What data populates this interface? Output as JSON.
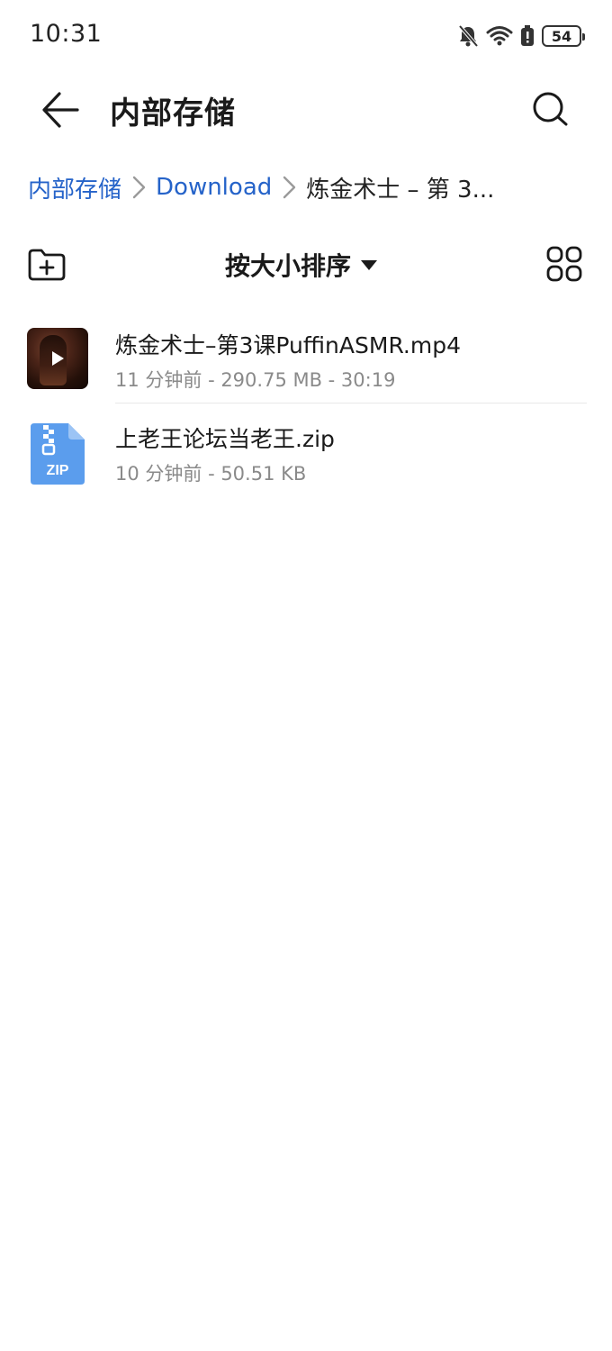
{
  "status_bar": {
    "time": "10:31",
    "icons": [
      "bell-off-icon",
      "wifi-icon",
      "alert-battery-icon"
    ],
    "battery": "54"
  },
  "title_bar": {
    "title": "内部存储",
    "back_icon": "arrow-left-icon",
    "search_icon": "search-icon"
  },
  "breadcrumb": [
    {
      "label": "内部存储",
      "link": true
    },
    {
      "label": "Download",
      "link": true
    },
    {
      "label": "炼金术士 – 第 3...",
      "link": false
    }
  ],
  "toolbar": {
    "new_folder_icon": "folder-add-icon",
    "sort_label": "按大小排序",
    "grid_icon": "grid-view-icon"
  },
  "files": [
    {
      "name": "炼金术士–第3课PuffinASMR.mp4",
      "meta": "11 分钟前 - 290.75 MB - 30:19",
      "type": "video"
    },
    {
      "name": "上老王论坛当老王.zip",
      "meta": "10 分钟前 - 50.51 KB",
      "type": "zip",
      "thumb_label": "ZIP"
    }
  ],
  "colors": {
    "link": "#2563c9",
    "zip_icon": "#5b9ded"
  }
}
